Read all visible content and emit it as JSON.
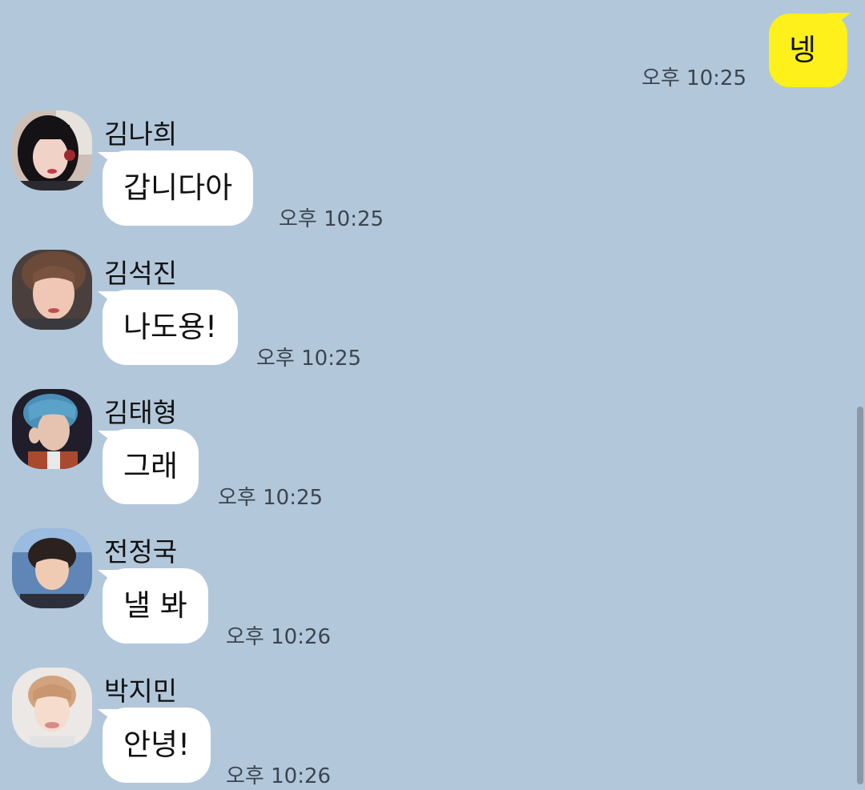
{
  "outgoing": {
    "text": "넹",
    "time": "오후 10:25"
  },
  "messages": [
    {
      "sender": "김나희",
      "text": "갑니다아",
      "time": "오후 10:25",
      "avatar": "avatar-girl-dark-hair"
    },
    {
      "sender": "김석진",
      "text": "나도용!",
      "time": "오후 10:25",
      "avatar": "avatar-man-brown-hair"
    },
    {
      "sender": "김태형",
      "text": "그래",
      "time": "오후 10:25",
      "avatar": "avatar-man-blue-hair"
    },
    {
      "sender": "전정국",
      "text": "낼 봐",
      "time": "오후 10:26",
      "avatar": "avatar-man-dark-hair"
    },
    {
      "sender": "박지민",
      "text": "안녕!",
      "time": "오후 10:26",
      "avatar": "avatar-man-light-hair"
    }
  ],
  "colors": {
    "background": "#b2c7da",
    "outgoing_bubble": "#fef01b",
    "incoming_bubble": "#ffffff",
    "time_text": "#3b4550"
  }
}
